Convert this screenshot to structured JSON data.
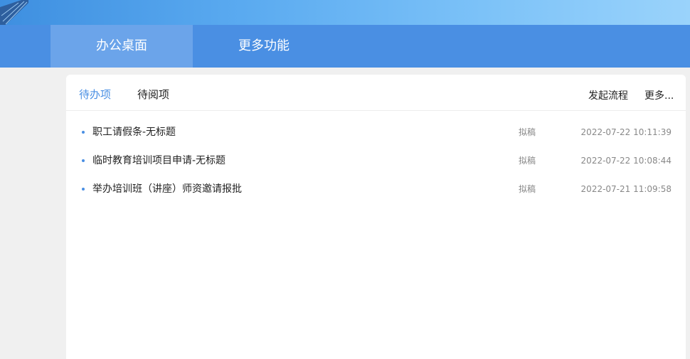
{
  "nav": {
    "tabs": [
      {
        "label": "办公桌面",
        "active": true
      },
      {
        "label": "更多功能",
        "active": false
      }
    ]
  },
  "card": {
    "tabs": [
      {
        "label": "待办项",
        "active": true
      },
      {
        "label": "待阅项",
        "active": false
      }
    ],
    "actions": {
      "start_process": "发起流程",
      "more": "更多..."
    },
    "items": [
      {
        "title": "职工请假条-无标题",
        "status": "拟稿",
        "time": "2022-07-22 10:11:39"
      },
      {
        "title": "临时教育培训项目申请-无标题",
        "status": "拟稿",
        "time": "2022-07-22 10:08:44"
      },
      {
        "title": "举办培训班（讲座）师资邀请报批",
        "status": "拟稿",
        "time": "2022-07-21 11:09:58"
      }
    ]
  },
  "colors": {
    "accent": "#4a8fe3",
    "nav_active": "#6ba4ea"
  }
}
